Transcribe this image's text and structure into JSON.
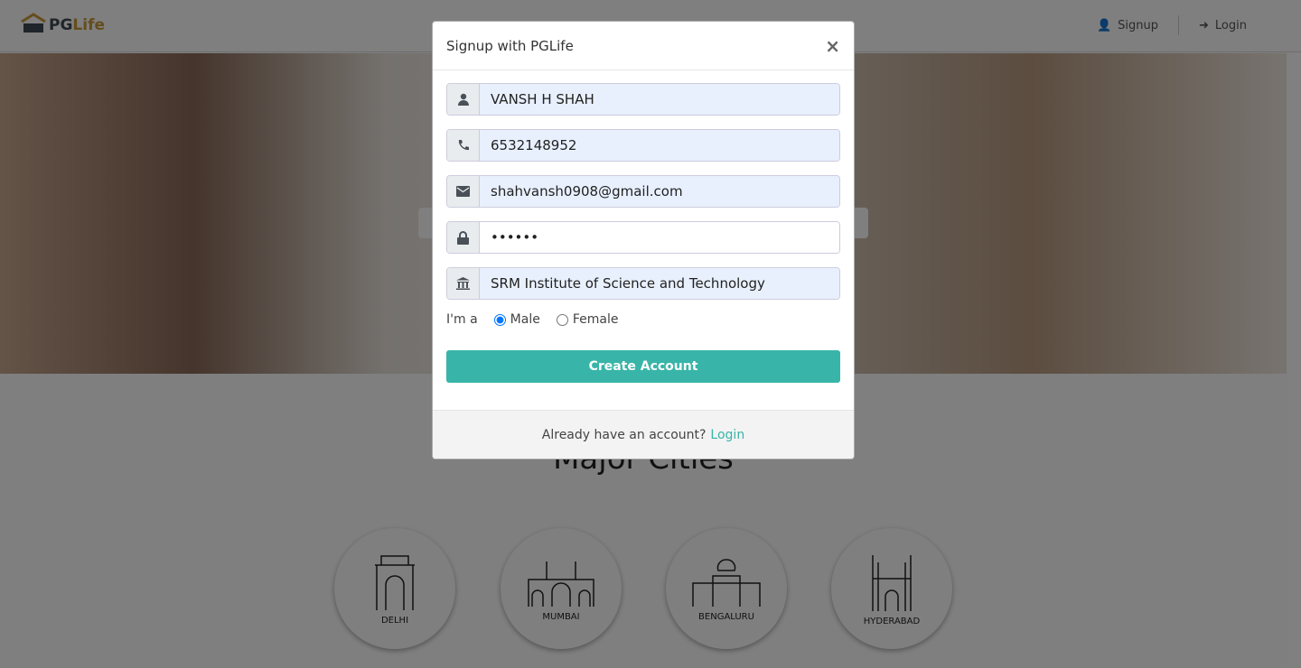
{
  "header": {
    "logo": {
      "part1": "PG",
      "part2": "Life"
    },
    "nav": [
      {
        "icon": "user-icon",
        "label": "Signup"
      },
      {
        "icon": "sign-in-icon",
        "label": "Login"
      }
    ]
  },
  "main": {
    "cities_title": "Major Cities",
    "cities": [
      "DELHI",
      "MUMBAI",
      "BENGALURU",
      "HYDERABAD"
    ]
  },
  "modal": {
    "title": "Signup with PGLife",
    "close": "×",
    "fields": [
      {
        "icon": "user-icon",
        "value": "VANSH H SHAH"
      },
      {
        "icon": "phone-icon",
        "value": "6532148952"
      },
      {
        "icon": "envelope-icon",
        "value": "shahvansh0908@gmail.com"
      },
      {
        "icon": "lock-icon",
        "value": "••••••"
      },
      {
        "icon": "university-icon",
        "value": "SRM Institute of Science and Technology"
      }
    ],
    "gender_label": "I'm a",
    "gender_options": [
      "Male",
      "Female"
    ],
    "gender_selected": "Male",
    "submit": "Create Account",
    "footer_text": "Already have an account?",
    "footer_link": "Login",
    "accent": "#38b5a8"
  }
}
